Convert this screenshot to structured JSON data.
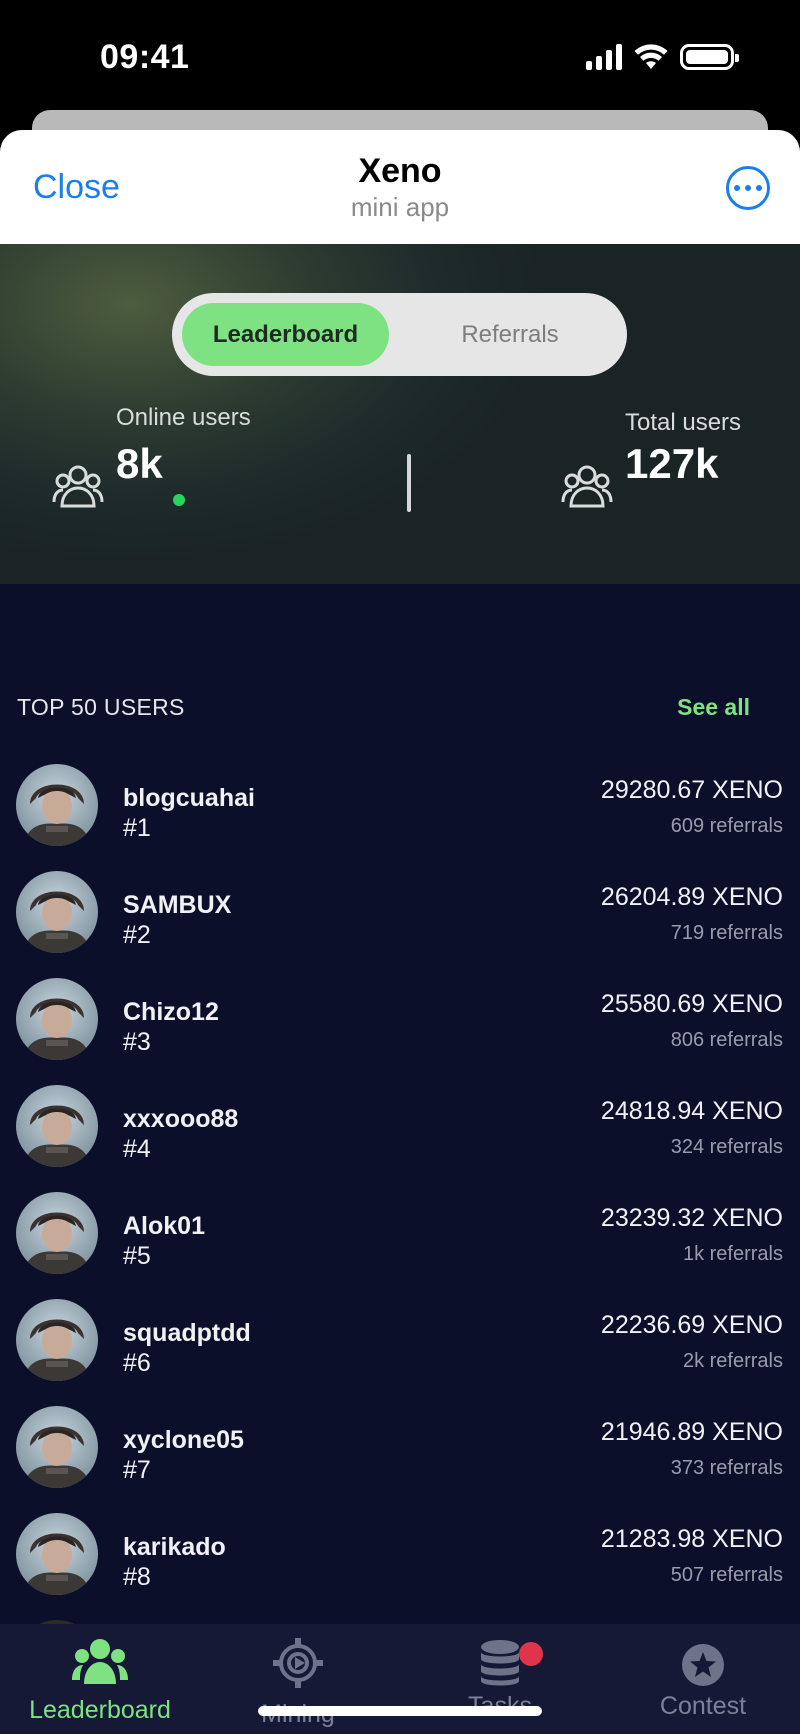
{
  "status_bar": {
    "time": "09:41"
  },
  "header": {
    "close_label": "Close",
    "title": "Xeno",
    "subtitle": "mini app"
  },
  "segmented": {
    "active": "Leaderboard",
    "inactive": "Referrals"
  },
  "stats": {
    "online_label": "Online users",
    "online_value": "8k",
    "total_label": "Total users",
    "total_value": "127k"
  },
  "leaderboard": {
    "section_title": "TOP 50 USERS",
    "see_all": "See all",
    "rows": [
      {
        "name": "blogcuahai",
        "rank": "#1",
        "amount": "29280.67 XENO",
        "referrals": "609 referrals"
      },
      {
        "name": "SAMBUX",
        "rank": "#2",
        "amount": "26204.89 XENO",
        "referrals": "719 referrals"
      },
      {
        "name": "Chizo12",
        "rank": "#3",
        "amount": "25580.69 XENO",
        "referrals": "806 referrals"
      },
      {
        "name": "xxxooo88",
        "rank": "#4",
        "amount": "24818.94 XENO",
        "referrals": "324 referrals"
      },
      {
        "name": "Alok01",
        "rank": "#5",
        "amount": "23239.32 XENO",
        "referrals": "1k referrals"
      },
      {
        "name": "squadptdd",
        "rank": "#6",
        "amount": "22236.69 XENO",
        "referrals": "2k referrals"
      },
      {
        "name": "xyclone05",
        "rank": "#7",
        "amount": "21946.89 XENO",
        "referrals": "373 referrals"
      },
      {
        "name": "karikado",
        "rank": "#8",
        "amount": "21283.98 XENO",
        "referrals": "507 referrals"
      }
    ]
  },
  "nav": {
    "items": [
      {
        "label": "Leaderboard",
        "icon": "users-icon",
        "active": true
      },
      {
        "label": "Mining",
        "icon": "mining-gear-icon",
        "active": false
      },
      {
        "label": "Tasks",
        "icon": "coins-stack-icon",
        "active": false
      },
      {
        "label": "Contest",
        "icon": "star-badge-icon",
        "active": false
      }
    ]
  },
  "colors": {
    "accent_green": "#7ee282",
    "link_blue": "#1a7ef1",
    "list_background": "#0b0f2a",
    "nav_background": "#151935",
    "badge_red": "#e0344a",
    "online_dot": "#26d65b"
  }
}
